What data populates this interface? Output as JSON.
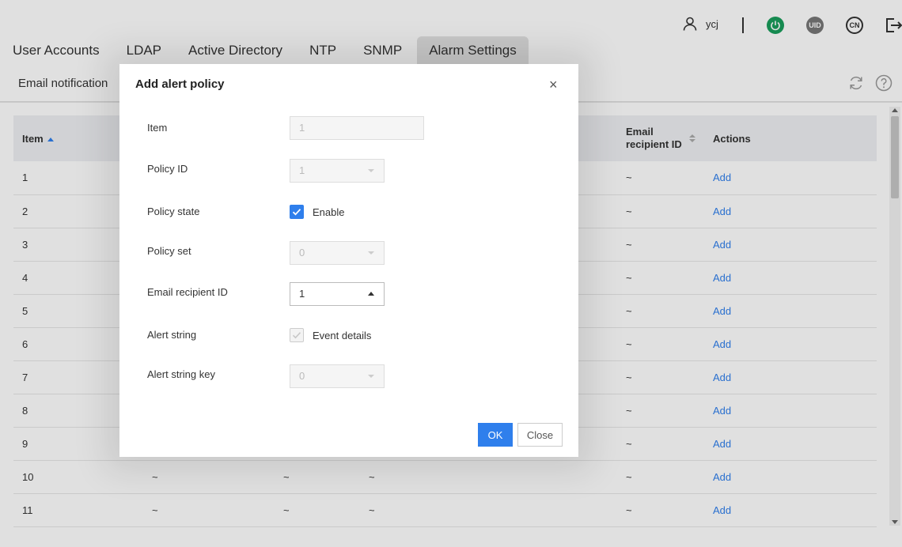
{
  "header": {
    "username": "ycj",
    "power_icon": "power-icon",
    "uid_label": "UID",
    "lang_label": "CN"
  },
  "tabs": [
    {
      "label": "User Accounts"
    },
    {
      "label": "LDAP"
    },
    {
      "label": "Active Directory"
    },
    {
      "label": "NTP"
    },
    {
      "label": "SNMP"
    },
    {
      "label": "Alarm Settings",
      "active": true
    }
  ],
  "subtab": {
    "label": "Email notification"
  },
  "table": {
    "headers": {
      "item": "Item",
      "email_recipient_id": "Email recipient ID",
      "actions": "Actions"
    },
    "rows": [
      {
        "item": "1",
        "c2": "",
        "c3": "",
        "c4": "",
        "email": "~",
        "action": "Add"
      },
      {
        "item": "2",
        "c2": "",
        "c3": "",
        "c4": "",
        "email": "~",
        "action": "Add"
      },
      {
        "item": "3",
        "c2": "",
        "c3": "",
        "c4": "",
        "email": "~",
        "action": "Add"
      },
      {
        "item": "4",
        "c2": "",
        "c3": "",
        "c4": "",
        "email": "~",
        "action": "Add"
      },
      {
        "item": "5",
        "c2": "",
        "c3": "",
        "c4": "",
        "email": "~",
        "action": "Add"
      },
      {
        "item": "6",
        "c2": "",
        "c3": "",
        "c4": "",
        "email": "~",
        "action": "Add"
      },
      {
        "item": "7",
        "c2": "",
        "c3": "",
        "c4": "",
        "email": "~",
        "action": "Add"
      },
      {
        "item": "8",
        "c2": "",
        "c3": "",
        "c4": "",
        "email": "~",
        "action": "Add"
      },
      {
        "item": "9",
        "c2": "",
        "c3": "",
        "c4": "",
        "email": "~",
        "action": "Add"
      },
      {
        "item": "10",
        "c2": "~",
        "c3": "~",
        "c4": "~",
        "email": "~",
        "action": "Add"
      },
      {
        "item": "11",
        "c2": "~",
        "c3": "~",
        "c4": "~",
        "email": "~",
        "action": "Add"
      }
    ]
  },
  "modal": {
    "title": "Add alert policy",
    "close_symbol": "×",
    "fields": {
      "item": {
        "label": "Item",
        "value": "1"
      },
      "policy_id": {
        "label": "Policy ID",
        "value": "1"
      },
      "policy_state": {
        "label": "Policy state",
        "checkbox_label": "Enable",
        "checked": true
      },
      "policy_set": {
        "label": "Policy set",
        "value": "0"
      },
      "email_recipient_id": {
        "label": "Email recipient ID",
        "value": "1"
      },
      "alert_string": {
        "label": "Alert string",
        "checkbox_label": "Event details",
        "checked": true,
        "disabled": true
      },
      "alert_string_key": {
        "label": "Alert string key",
        "value": "0"
      }
    },
    "ok_label": "OK",
    "close_label": "Close"
  },
  "colors": {
    "accent": "#2f7fec",
    "power": "#1a9e5c"
  }
}
